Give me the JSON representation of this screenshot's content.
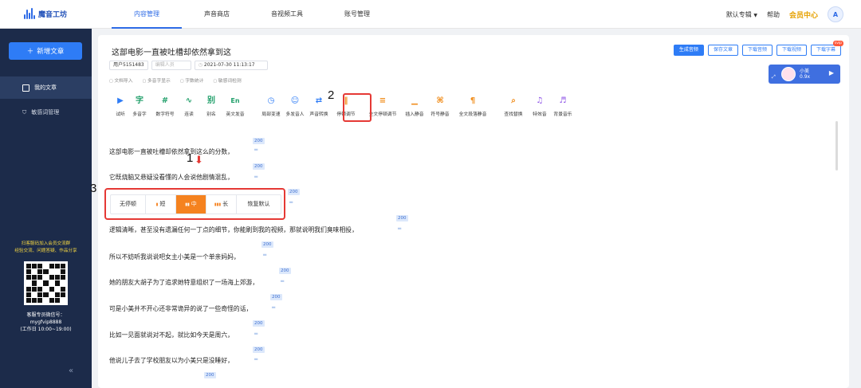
{
  "app": {
    "name": "魔音工坊"
  },
  "top_nav": {
    "tabs": [
      "内容管理",
      "声音商店",
      "音视频工具",
      "账号管理"
    ],
    "active_index": 0,
    "default_album": "默认专辑",
    "help": "帮助",
    "vip": "会员中心",
    "user_initial": "A"
  },
  "sidebar": {
    "new_article": "新增文章",
    "items": [
      {
        "label": "我的文章",
        "active": true
      },
      {
        "label": "敏感词管理",
        "active": false
      }
    ],
    "promo_line1": "扫客服码加入会员交流群",
    "promo_line2": "经验交流、问题答疑、作品分享",
    "contact_line1": "客服专员微信号：",
    "contact_line2": "mygfvip8888",
    "contact_line3": "(工作日 10:00~19:00)",
    "collapse_icon": "«"
  },
  "document": {
    "title": "这部电影一直被吐槽却依然拿到这",
    "user_field": "用户5151483",
    "editor_placeholder": "编辑人员",
    "datetime": "2021-07-30 11:13:17",
    "meta_tools": [
      "文档导入",
      "多音字显示",
      "字数统计",
      "敏感词检测"
    ]
  },
  "actions": {
    "generate": "生成音频",
    "save": "保存文章",
    "download_audio": "下载音频",
    "download_video": "下载视频",
    "download_subtitle": "下载字幕",
    "svip": "svip"
  },
  "voice_card": {
    "name": "小美",
    "speed": "0.9x"
  },
  "toolbar": [
    {
      "label": "试听",
      "icon": "play-icon",
      "glyph": "▶",
      "color": "#2e7cf6"
    },
    {
      "label": "多音字",
      "icon": "polyphone-icon",
      "glyph": "字",
      "color": "#22a06b"
    },
    {
      "label": "数字符号",
      "icon": "number-icon",
      "glyph": "#",
      "color": "#22a06b"
    },
    {
      "label": "连读",
      "icon": "linking-icon",
      "glyph": "∿",
      "color": "#22a06b"
    },
    {
      "label": "别名",
      "icon": "alias-icon",
      "glyph": "别",
      "color": "#22a06b"
    },
    {
      "label": "英文发音",
      "icon": "english-icon",
      "glyph": "En",
      "color": "#22a06b"
    },
    {
      "label": "局部变速",
      "icon": "speed-icon",
      "glyph": "◷",
      "color": "#2e7cf6"
    },
    {
      "label": "多发音人",
      "icon": "multi-speaker-icon",
      "glyph": "☺",
      "color": "#2e7cf6"
    },
    {
      "label": "声音转换",
      "icon": "voice-convert-icon",
      "glyph": "⇄",
      "color": "#2e7cf6"
    },
    {
      "label": "停顿调节",
      "icon": "pause-adjust-icon",
      "glyph": "‖",
      "color": "#f08c1a"
    },
    {
      "label": "全文停顿调节",
      "icon": "full-pause-icon",
      "glyph": "≡",
      "color": "#f08c1a"
    },
    {
      "label": "插入静音",
      "icon": "insert-silence-icon",
      "glyph": "▁",
      "color": "#f08c1a"
    },
    {
      "label": "符号静音",
      "icon": "symbol-silence-icon",
      "glyph": "⌘",
      "color": "#f08c1a"
    },
    {
      "label": "全文段落静音",
      "icon": "paragraph-silence-icon",
      "glyph": "¶",
      "color": "#f08c1a"
    },
    {
      "label": "查找替换",
      "icon": "find-replace-icon",
      "glyph": "⌕",
      "color": "#f08c1a"
    },
    {
      "label": "特效音",
      "icon": "sound-effect-icon",
      "glyph": "♫",
      "color": "#8a4ee6"
    },
    {
      "label": "背景音乐",
      "icon": "bgm-icon",
      "glyph": "♬",
      "color": "#8a4ee6"
    }
  ],
  "annotations": [
    "1",
    "2",
    "3"
  ],
  "pause_popup": {
    "options": [
      "无停顿",
      "短",
      "中",
      "长",
      "恢复默认"
    ],
    "selected_index": 2
  },
  "badge_value": "200",
  "lines": [
    "这部电影一直被吐槽却依然拿到这么的分数，",
    "它既烧脑又悬疑没看懂的人会说他剧情混乱，",
    "逻辑清晰，甚至没有遗漏任何一丁点的细节，你能刷到我的视频，那就说明我们臭味相投，",
    "所以不妨听我说说吧女主小美是一个单亲妈妈，",
    "她的朋友大胡子为了追求她特意组织了一场海上郊游，",
    "可是小美并不开心还非常诡异的说了一些奇怪的话，",
    "比如一见面就说对不起，就比如今天是周六，",
    "他说儿子去了学校朋友以为小美只是没睡好，"
  ]
}
